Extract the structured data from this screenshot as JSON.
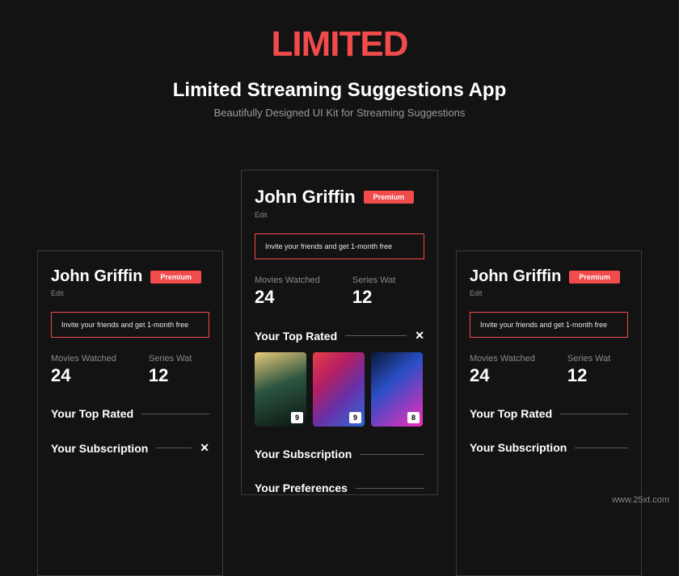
{
  "header": {
    "brand": "LIMITED",
    "title": "Limited Streaming Suggestions App",
    "subtitle": "Beautifully Designed UI Kit for Streaming Suggestions"
  },
  "profile": {
    "name": "John Griffin",
    "badge": "Premium",
    "edit": "Edit",
    "invite": "Invite your friends and get 1-month free"
  },
  "stats": {
    "movies_label": "Movies Watched",
    "movies_value": "24",
    "series_label": "Series Wat",
    "series_value": "12"
  },
  "sections": {
    "top_rated": "Your Top Rated",
    "subscription": "Your Subscription",
    "preferences": "Your Preferences"
  },
  "posters": [
    {
      "rating": "9"
    },
    {
      "rating": "9"
    },
    {
      "rating": "8"
    }
  ],
  "watermark": "www.25xt.com",
  "colors": {
    "accent": "#f14b4b",
    "bg": "#131313",
    "border": "#3a3a3a"
  }
}
